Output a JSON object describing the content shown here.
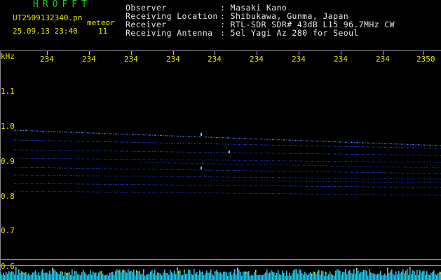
{
  "header": {
    "brand": "HROFFT",
    "filename": "UT2509132340.pn",
    "meteor_label": "meteor",
    "timestamp": "25.09.13 23:40",
    "count": "11",
    "fields": [
      {
        "label": "Observer",
        "value": ": Masaki Kano"
      },
      {
        "label": "Receiving Location",
        "value": ": Shibukawa, Gunma, Japan"
      },
      {
        "label": "Receiver",
        "value": ": RTL-SDR SDR# 43dB L15 96.7MHz CW"
      },
      {
        "label": "Receiving Antenna",
        "value": ": 5el Yagi Az 280 for Seoul"
      }
    ]
  },
  "axis": {
    "unit": "kHz",
    "time_ticks": [
      "234",
      "234",
      "234",
      "234",
      "234",
      "234",
      "234",
      "234",
      "234",
      "2350"
    ],
    "freq_ticks": [
      "1.1",
      "1.0",
      "0.9",
      "0.8",
      "0.7",
      "0.6"
    ]
  },
  "colors": {
    "trace": "#2a4cff",
    "trace_bright": "#5a7cff",
    "noise": "#20c8e8",
    "noise_peak": "#e0e020",
    "label": "#e6e600",
    "brand": "#18d018"
  }
}
